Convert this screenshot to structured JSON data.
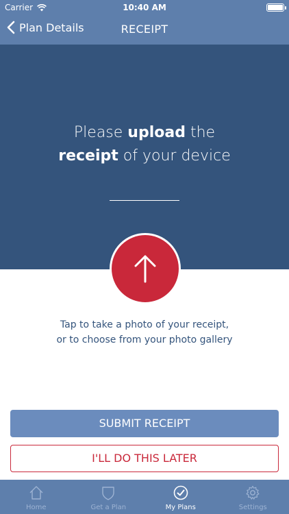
{
  "status_bar": {
    "carrier": "Carrier",
    "time": "10:40 AM"
  },
  "nav": {
    "back_label": "Plan Details",
    "title": "RECEIPT"
  },
  "hero": {
    "line1_pre": "Please ",
    "line1_bold": "upload",
    "line1_post": " the",
    "line2_bold": "receipt",
    "line2_post": " of your device"
  },
  "hint": {
    "line1": "Tap to take a photo of your receipt,",
    "line2": "or to choose from your photo gallery"
  },
  "buttons": {
    "submit": "SUBMIT RECEIPT",
    "later": "I'LL DO THIS LATER"
  },
  "tabs": [
    {
      "label": "Home",
      "icon": "home-icon"
    },
    {
      "label": "Get a Plan",
      "icon": "shield-icon"
    },
    {
      "label": "My Plans",
      "icon": "check-circle-icon",
      "active": true
    },
    {
      "label": "Settings",
      "icon": "gear-icon"
    }
  ],
  "colors": {
    "nav": "#5e7fac",
    "hero": "#34547c",
    "accent_red": "#c9283a",
    "button_blue": "#6b8cbd"
  }
}
